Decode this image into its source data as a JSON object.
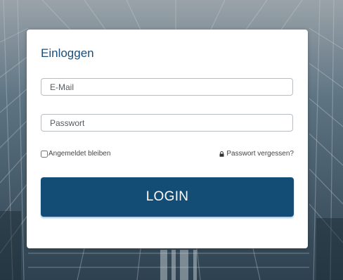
{
  "login_form": {
    "title": "Einloggen",
    "email_placeholder": "E-Mail",
    "password_placeholder": "Passwort",
    "remember_label": "Angemeldet bleiben",
    "forgot_label": "Passwort vergessen?",
    "login_label": "LOGIN"
  },
  "icons": {
    "forgot": "lock-icon"
  },
  "colors": {
    "accent": "#134c75",
    "title": "#1b4e78",
    "button_text": "#ffffff"
  }
}
